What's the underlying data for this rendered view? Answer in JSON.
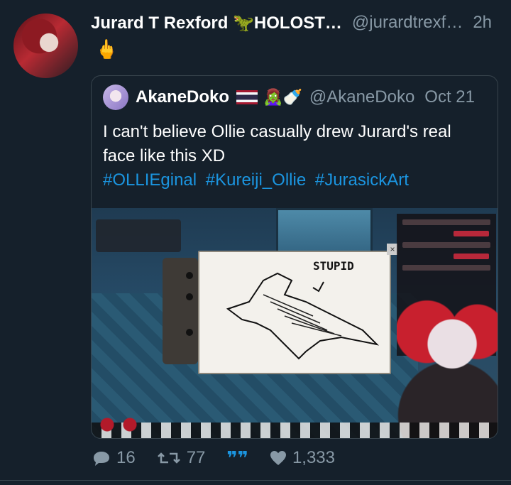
{
  "tweet": {
    "author_name": "Jurard T Rexford 🦖HOLOST…",
    "handle": "@jurardtrexf…",
    "time": "2h",
    "text": "🖕"
  },
  "quoted": {
    "author_name": "AkaneDoko",
    "emoji": "🧟‍♀️🍼",
    "handle": "@AkaneDoko",
    "time": "Oct 21",
    "text": "I can't believe Ollie casually drew Jurard's real face like this XD",
    "hashtags": [
      "#OLLIEginal",
      "#Kureiji_Ollie",
      "#JurasickArt"
    ],
    "media_caption": "STUPID"
  },
  "actions": {
    "replies": "16",
    "retweets": "77",
    "likes": "1,333"
  },
  "colors": {
    "background": "#15202b",
    "link": "#1b95e0",
    "muted": "#8899a6",
    "border": "#38444d"
  }
}
